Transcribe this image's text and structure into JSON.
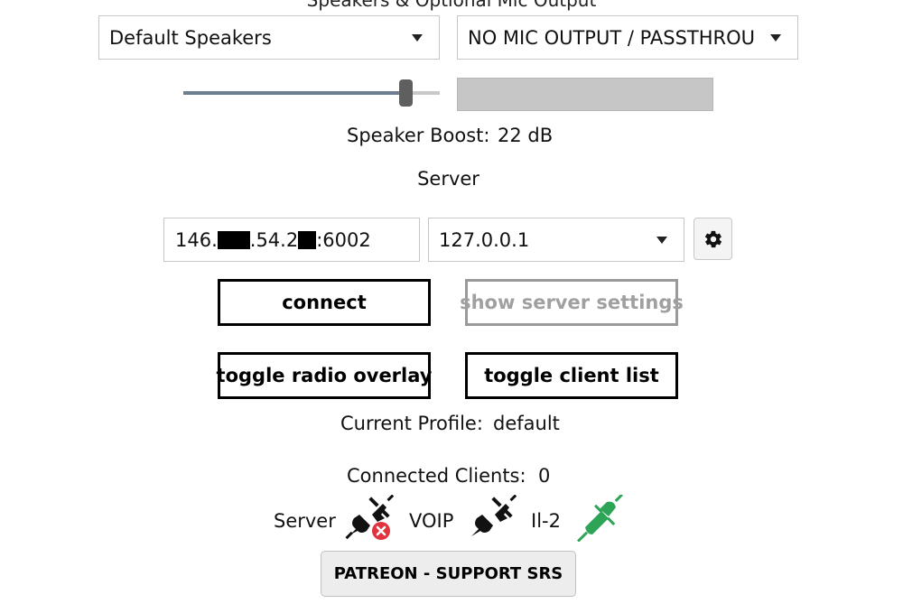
{
  "audio": {
    "section_title": "Speakers & Optional Mic Output",
    "speaker_device": "Default Speakers",
    "mic_output_device": "NO MIC OUTPUT / PASSTHROU",
    "speaker_volume_fraction": 0.87,
    "speaker_boost_label": "Speaker Boost:",
    "speaker_boost_value": "22 dB"
  },
  "server": {
    "section_label": "Server",
    "address_part1": "146.",
    "address_part2": ".54.2",
    "address_part3": ":6002",
    "bind_address": "127.0.0.1",
    "settings_icon": "gear-icon"
  },
  "buttons": {
    "connect": "connect",
    "show_server_settings": "show server settings",
    "toggle_radio_overlay": "toggle radio overlay",
    "toggle_client_list": "toggle client list",
    "patreon": "PATREON - SUPPORT SRS"
  },
  "profile": {
    "label": "Current Profile:",
    "value": "default"
  },
  "clients": {
    "label": "Connected Clients:",
    "value": "0"
  },
  "status": {
    "server_label": "Server",
    "server_icon": "plug-disconnected-icon",
    "voip_label": "VOIP",
    "voip_icon": "plug-disconnected-icon",
    "game_label": "Il-2",
    "game_icon": "plug-connected-icon",
    "connected_color": "#2ea457",
    "error_color": "#e0353f"
  }
}
